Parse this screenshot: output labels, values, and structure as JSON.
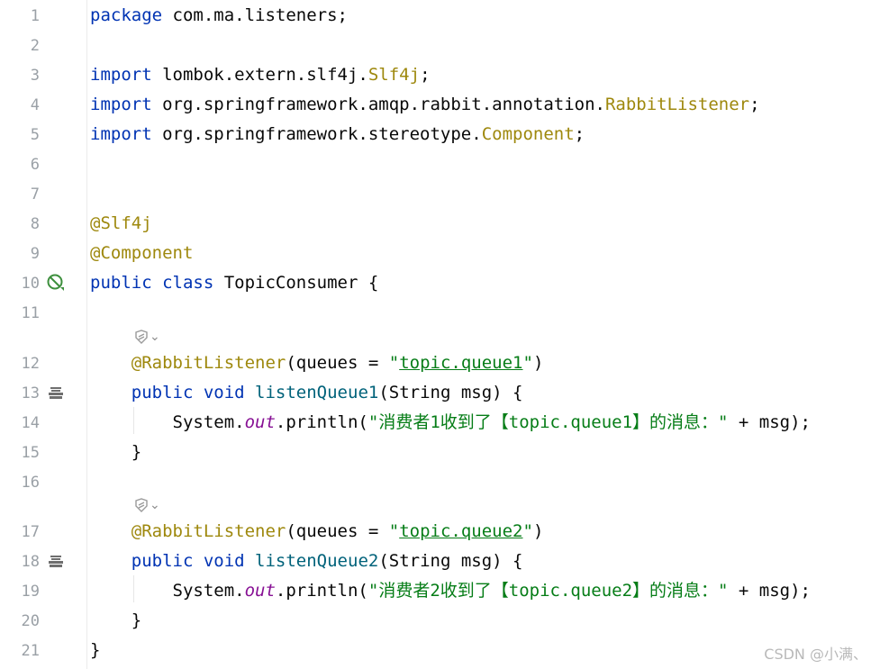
{
  "editor": {
    "line_numbers": [
      "1",
      "2",
      "3",
      "4",
      "5",
      "6",
      "7",
      "8",
      "9",
      "10",
      "11",
      "12",
      "13",
      "14",
      "15",
      "16",
      "17",
      "18",
      "19",
      "20",
      "21"
    ],
    "code": {
      "l1_kw": "package",
      "l1_rest": " com.ma.listeners;",
      "l3_kw": "import",
      "l3_pkg": " lombok.extern.slf4j.",
      "l3_cls": "Slf4j",
      "l3_end": ";",
      "l4_kw": "import",
      "l4_pkg": " org.springframework.amqp.rabbit.annotation.",
      "l4_cls": "RabbitListener",
      "l4_end": ";",
      "l5_kw": "import",
      "l5_pkg": " org.springframework.stereotype.",
      "l5_cls": "Component",
      "l5_end": ";",
      "l8_ann": "@Slf4j",
      "l9_ann": "@Component",
      "l10_kw": "public class",
      "l10_rest": " TopicConsumer {",
      "l12_ann": "@RabbitListener",
      "l12_a": "(queues = ",
      "l12_q1": "\"",
      "l12_str": "topic.queue1",
      "l12_q2": "\"",
      "l12_end": ")",
      "l13_kw": "public void",
      "l13_fn": " listenQueue1",
      "l13_rest": "(String msg) {",
      "l14_a": "System.",
      "l14_fld": "out",
      "l14_b": ".println(",
      "l14_str": "\"消费者1收到了【topic.queue1】的消息：\"",
      "l14_end": " + msg);",
      "l15": "}",
      "l17_ann": "@RabbitListener",
      "l17_a": "(queues = ",
      "l17_q1": "\"",
      "l17_str": "topic.queue2",
      "l17_q2": "\"",
      "l17_end": ")",
      "l18_kw": "public void",
      "l18_fn": " listenQueue2",
      "l18_rest": "(String msg) {",
      "l19_a": "System.",
      "l19_fld": "out",
      "l19_b": ".println(",
      "l19_str": "\"消费者2收到了【topic.queue2】的消息：\"",
      "l19_end": " + msg);",
      "l20": "}",
      "l21": "}"
    },
    "hint_chevron": "⌄"
  },
  "watermark": "CSDN @小满、",
  "colors": {
    "keyword": "#0033b3",
    "annotation": "#9e880d",
    "string": "#067d17",
    "method": "#00627a",
    "static_field": "#871094"
  },
  "icons": [
    "no-entry-icon",
    "bean-icon",
    "spring-hint-icon"
  ]
}
